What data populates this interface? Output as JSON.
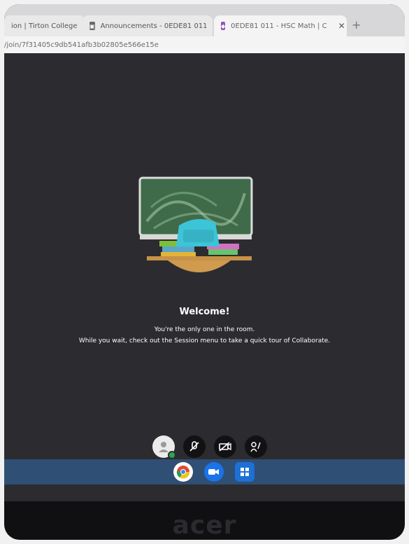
{
  "browser": {
    "tabs": [
      {
        "label": "ion | Tirton College"
      },
      {
        "label": "Announcements - 0EDE81 011"
      },
      {
        "label": "0EDE81 011 - HSC Math | C"
      }
    ],
    "url": "/join/7f31405c9db541afb3b02805e566e15e",
    "new_tab": "+"
  },
  "main": {
    "welcome_title": "Welcome!",
    "message_line1": "You're the only one in the room.",
    "message_line2": "While you wait, check out the Session menu to take a quick tour of Collaborate."
  },
  "icons": {
    "tab_favicon_1": "announcements-icon",
    "tab_favicon_2": "collaborate-icon",
    "record": "record-icon",
    "avatar": "user-avatar-icon",
    "mic": "mic-muted-icon",
    "camera": "camera-off-icon",
    "raise_hand": "raise-hand-icon",
    "chrome": "chrome-icon",
    "meet": "meet-icon",
    "files": "files-icon"
  },
  "colors": {
    "accent": "#2aa84a",
    "record": "#e32020",
    "shelf": "#2f4f75"
  },
  "device": {
    "brand": "acer"
  }
}
